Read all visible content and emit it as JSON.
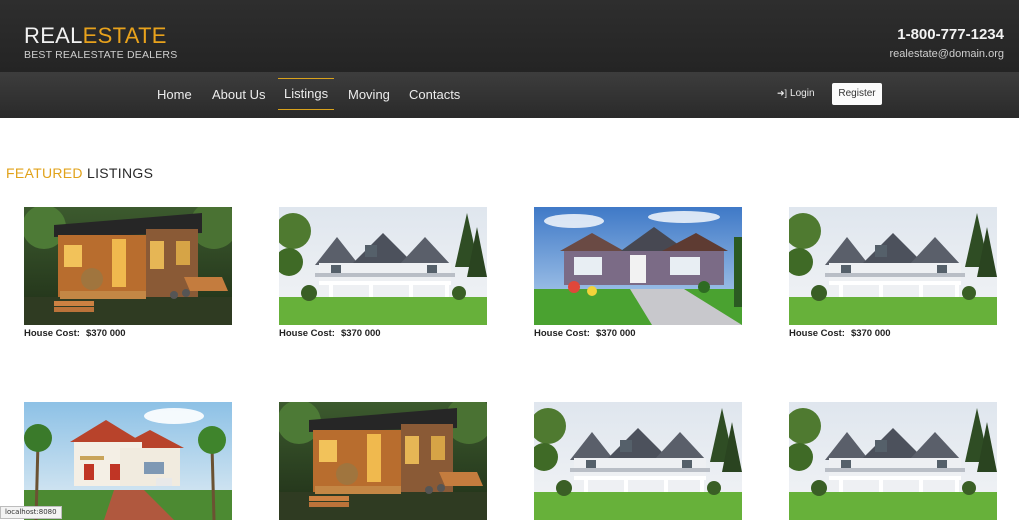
{
  "brand": {
    "logo_part1": "REAL",
    "logo_part2": "ESTATE",
    "tagline": "BEST REALESTATE DEALERS"
  },
  "contact": {
    "phone": "1-800-777-1234",
    "email": "realestate@domain.org"
  },
  "nav": {
    "items": [
      {
        "label": "Home"
      },
      {
        "label": "About Us"
      },
      {
        "label": "Listings",
        "active": true
      },
      {
        "label": "Moving"
      },
      {
        "label": "Contacts"
      }
    ],
    "login_label": "Login",
    "register_label": "Register"
  },
  "featured": {
    "title_part1": "FEATURED",
    "title_part2": "LISTINGS"
  },
  "listings": [
    {
      "image": "tiny-cabin",
      "cost_label": "House Cost:",
      "cost_value": "$370 000"
    },
    {
      "image": "white-farmhouse",
      "cost_label": "House Cost:",
      "cost_value": "$370 000"
    },
    {
      "image": "purple-bungalow",
      "cost_label": "House Cost:",
      "cost_value": "$370 000"
    },
    {
      "image": "white-farmhouse",
      "cost_label": "House Cost:",
      "cost_value": "$370 000"
    },
    {
      "image": "tropical-villa",
      "cost_label": "",
      "cost_value": ""
    },
    {
      "image": "tiny-cabin",
      "cost_label": "",
      "cost_value": ""
    },
    {
      "image": "white-farmhouse",
      "cost_label": "",
      "cost_value": ""
    },
    {
      "image": "white-farmhouse",
      "cost_label": "",
      "cost_value": ""
    }
  ],
  "status_bar": {
    "url": "localhost:8080"
  },
  "colors": {
    "accent": "#e1a21a",
    "header_bg": "#2b2b2b",
    "nav_bg": "#353535"
  }
}
